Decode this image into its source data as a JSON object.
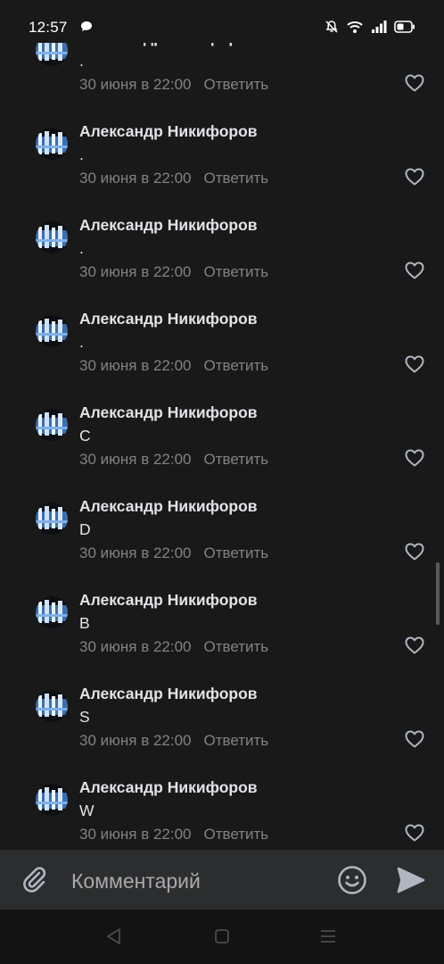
{
  "status_bar": {
    "time": "12:57",
    "icons": [
      "chat-bubble-icon",
      "bell-muted-icon",
      "wifi-icon",
      "signal-icon",
      "battery-icon"
    ]
  },
  "comments": [
    {
      "author": "Александр Никифоров",
      "text": ".",
      "date": "30 июня в 22:00",
      "reply_label": "Ответить"
    },
    {
      "author": "Александр Никифоров",
      "text": ".",
      "date": "30 июня в 22:00",
      "reply_label": "Ответить"
    },
    {
      "author": "Александр Никифоров",
      "text": ".",
      "date": "30 июня в 22:00",
      "reply_label": "Ответить"
    },
    {
      "author": "Александр Никифоров",
      "text": ".",
      "date": "30 июня в 22:00",
      "reply_label": "Ответить"
    },
    {
      "author": "Александр Никифоров",
      "text": "C",
      "date": "30 июня в 22:00",
      "reply_label": "Ответить"
    },
    {
      "author": "Александр Никифоров",
      "text": "D",
      "date": "30 июня в 22:00",
      "reply_label": "Ответить"
    },
    {
      "author": "Александр Никифоров",
      "text": "B",
      "date": "30 июня в 22:00",
      "reply_label": "Ответить"
    },
    {
      "author": "Александр Никифоров",
      "text": "S",
      "date": "30 июня в 22:00",
      "reply_label": "Ответить"
    },
    {
      "author": "Александр Никифоров",
      "text": "W",
      "date": "30 июня в 22:00",
      "reply_label": "Ответить"
    }
  ],
  "input_bar": {
    "placeholder": "Комментарий",
    "icons": [
      "paperclip-icon",
      "emoji-icon",
      "send-icon"
    ]
  },
  "nav_bar": {
    "icons": [
      "back-triangle-icon",
      "home-square-icon",
      "menu-lines-icon"
    ]
  },
  "colors": {
    "background": "#19191a",
    "primary_text": "#e1e3e6",
    "secondary_text": "#828282",
    "input_bar": "#2c2d2e",
    "icon": "#aeb7c2"
  }
}
